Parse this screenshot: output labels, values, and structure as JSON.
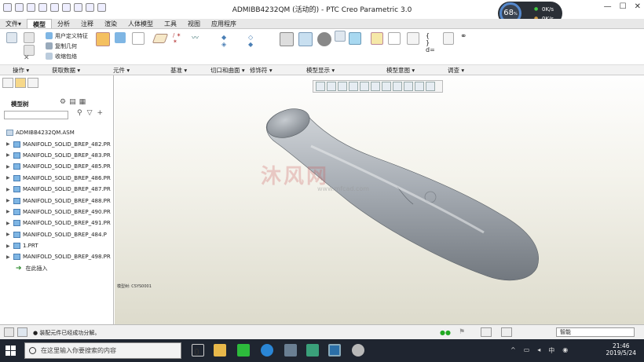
{
  "window": {
    "title": "ADMIBB4232QM (活动的) - PTC Creo Parametric 3.0"
  },
  "gauge": {
    "percent": "68",
    "unit": "%",
    "rate1": "0K/s",
    "rate2": "0K/s"
  },
  "tabs": [
    "文件▾",
    "模型",
    "分析",
    "注释",
    "渲染",
    "人体模型",
    "工具",
    "视图",
    "应用程序"
  ],
  "ribbon": {
    "user_feature": "用户定义特征",
    "copy_geometry": "复制几何",
    "shrinkwrap": "收缩包络"
  },
  "groups": [
    "操作 ▾",
    "获取数据 ▾",
    "元件 ▾",
    "基准 ▾",
    "切口和曲面 ▾",
    "修饰符 ▾",
    "模型显示 ▾",
    "模型意图 ▾",
    "调查 ▾"
  ],
  "tree": {
    "title": "模型树",
    "root": "ADMIBB4232QM.ASM",
    "items": [
      "MANIFOLD_SOLID_BREP_482.PR",
      "MANIFOLD_SOLID_BREP_483.PR",
      "MANIFOLD_SOLID_BREP_485.PR",
      "MANIFOLD_SOLID_BREP_486.PR",
      "MANIFOLD_SOLID_BREP_487.PR",
      "MANIFOLD_SOLID_BREP_488.PR",
      "MANIFOLD_SOLID_BREP_490.PR",
      "MANIFOLD_SOLID_BREP_491.PR",
      "MANIFOLD_SOLID_BREP_484.P",
      "1.PRT",
      "MANIFOLD_SOLID_BREP_498.PR"
    ],
    "insert_here": "在此插入"
  },
  "viewport": {
    "label": "模型树: CSYS0001",
    "watermark": "沐风网",
    "watermark_url": "www.mfcad.com"
  },
  "status": {
    "message": "● 装配元件已经成功分解。",
    "filter": "智能"
  },
  "taskbar": {
    "search_placeholder": "在这里输入你要搜索的内容",
    "time": "21:46",
    "date": "2019/5/24"
  }
}
